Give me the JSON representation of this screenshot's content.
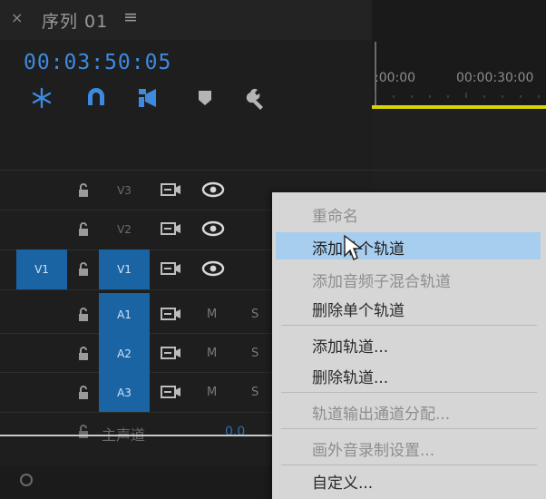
{
  "header": {
    "close": "×",
    "title": "序列 01",
    "menu": "≡"
  },
  "timecode": "00:03:50:05",
  "toolbar": {
    "icons": [
      "snap-icon",
      "magnet-icon",
      "add-marker-icon",
      "marker-icon",
      "wrench-icon"
    ]
  },
  "ruler": {
    "labels": [
      ":00:00",
      "00:00:30:00"
    ]
  },
  "tracks": {
    "video": [
      {
        "name": "V3",
        "source": ""
      },
      {
        "name": "V2",
        "source": ""
      },
      {
        "name": "V1",
        "source": "V1"
      }
    ],
    "audio": [
      {
        "name": "A1",
        "m": "M",
        "s": "S"
      },
      {
        "name": "A2",
        "m": "M",
        "s": "S"
      },
      {
        "name": "A3",
        "m": "M",
        "s": "S"
      }
    ],
    "master": {
      "label": "主声道",
      "value": "0.0"
    }
  },
  "context_menu": {
    "items": [
      {
        "label": "重命名",
        "enabled": false
      },
      {
        "label": "添加单个轨道",
        "enabled": true,
        "highlighted": true
      },
      {
        "label": "添加音频子混合轨道",
        "enabled": false
      },
      {
        "label": "删除单个轨道",
        "enabled": true
      },
      {
        "label": "添加轨道...",
        "enabled": true
      },
      {
        "label": "删除轨道...",
        "enabled": true
      },
      {
        "label": "轨道输出通道分配...",
        "enabled": false
      },
      {
        "label": "画外音录制设置...",
        "enabled": false
      },
      {
        "label": "自定义...",
        "enabled": true
      }
    ]
  },
  "colors": {
    "accent": "#3d8ae0",
    "track_active": "#1a64a4",
    "work_area": "#d5d500",
    "menu_highlight": "#a7cdef"
  }
}
